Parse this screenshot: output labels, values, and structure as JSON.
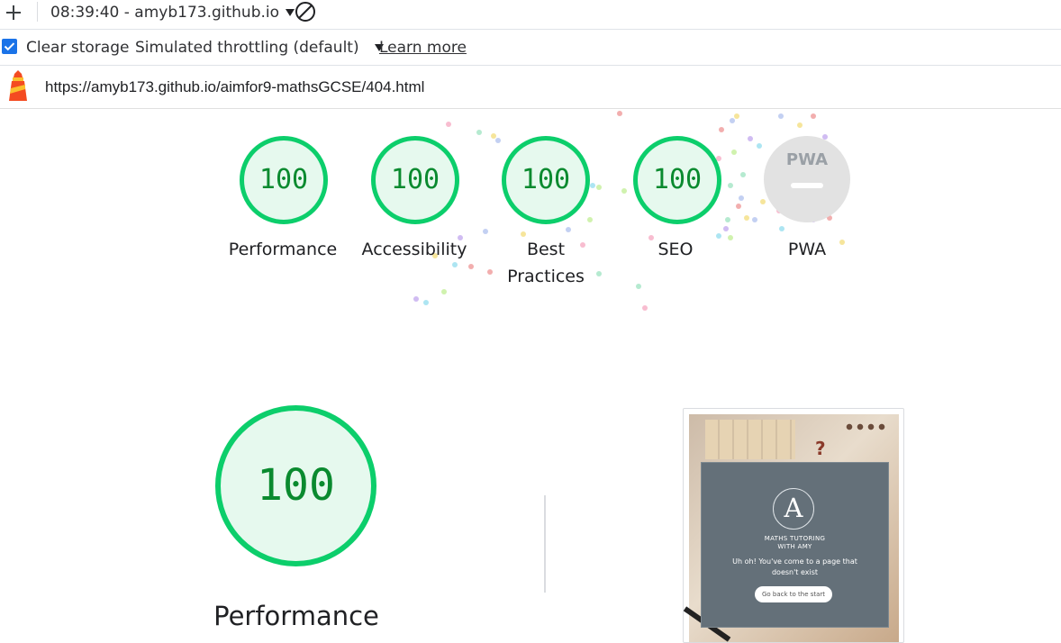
{
  "toolbar": {
    "add_icon": "plus-icon",
    "report_selector": "08:39:40 - amyb173.github.io",
    "dropdown_icon": "caret-down-icon",
    "clear_icon": "block-icon"
  },
  "settings": {
    "clear_storage_label": "Clear storage",
    "clear_storage_checked": true,
    "throttling_label": "Simulated throttling (default)",
    "learn_more": "Learn more"
  },
  "url_bar": {
    "icon": "lighthouse-icon",
    "url": "https://amyb173.github.io/aimfor9-mathsGCSE/404.html"
  },
  "scores": [
    {
      "label": "Performance",
      "value": "100"
    },
    {
      "label": "Accessibility",
      "value": "100"
    },
    {
      "label": "Best Practices",
      "value": "100"
    },
    {
      "label": "SEO",
      "value": "100"
    },
    {
      "label": "PWA",
      "value": "PWA"
    }
  ],
  "detail": {
    "score": "100",
    "title": "Performance"
  },
  "screenshot": {
    "logo_letter": "A",
    "brand_line1": "MATHS TUTORING",
    "brand_line2": "WITH AMY",
    "message_line1": "Uh oh! You've come to a page that",
    "message_line2": "doesn't exist",
    "button": "Go back to the start"
  },
  "colors": {
    "pass_green": "#0cce6b",
    "pass_fill": "#e6f9ee",
    "pass_text": "#0a8a2f",
    "pwa_gray": "#e0e0e0",
    "link_blue": "#1a73e8",
    "checkbox_blue": "#1a73e8"
  }
}
